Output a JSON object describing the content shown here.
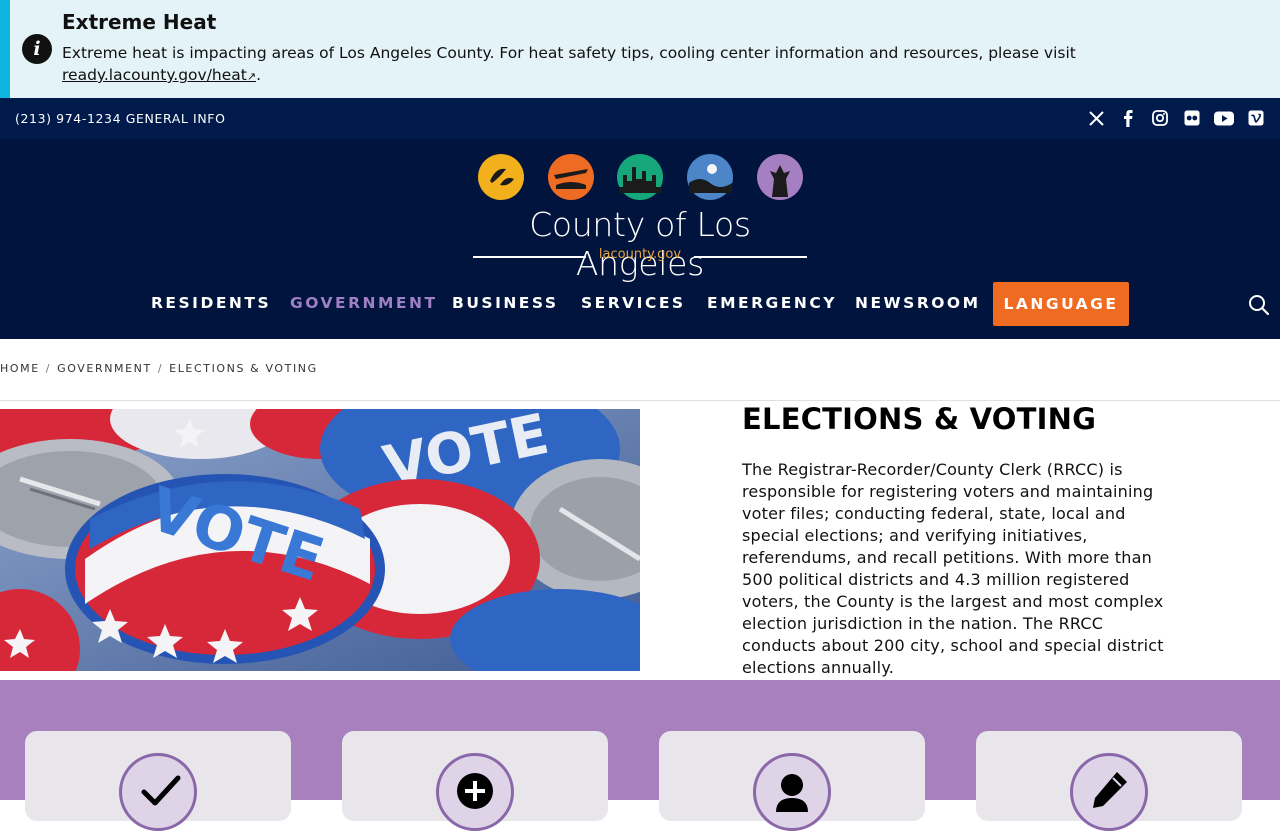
{
  "alert": {
    "title": "Extreme Heat",
    "text": "Extreme heat is impacting areas of Los Angeles County. For heat safety tips, cooling center information and resources, please visit",
    "link": "ready.lacounty.gov/heat",
    "icon": "info-icon"
  },
  "topbar": {
    "phone": "(213) 974-1234 GENERAL INFO",
    "social": [
      "x-icon",
      "facebook-icon",
      "instagram-icon",
      "flickr-icon",
      "youtube-icon",
      "vimeo-icon"
    ]
  },
  "logo": {
    "title": "County of Los Angeles",
    "subtitle": "lacounty.gov"
  },
  "nav": {
    "items": [
      "RESIDENTS",
      "GOVERNMENT",
      "BUSINESS",
      "SERVICES",
      "EMERGENCY",
      "NEWSROOM"
    ],
    "active": "GOVERNMENT",
    "language": "LANGUAGE"
  },
  "breadcrumb": [
    "HOME",
    "GOVERNMENT",
    "ELECTIONS & VOTING"
  ],
  "main": {
    "title": "ELECTIONS & VOTING",
    "intro": "The Registrar-Recorder/County Clerk (RRCC) is responsible for registering voters and maintaining voter files; conducting federal, state, local and special elections; and verifying initiatives, referendums, and recall petitions. With more than 500 political districts and 4.3 million registered voters, the County is the largest and most complex election jurisdiction in the nation. The RRCC conducts about 200 city, school and special district elections annually.",
    "image_text": "VOTE"
  },
  "cards": [
    "check-icon",
    "plus-circle-icon",
    "user-icon",
    "pencil-icon"
  ],
  "colors": {
    "alert_bg": "#e4f3f8",
    "alert_accent": "#0db4e0",
    "topbar": "#001a4c",
    "header": "#00143d",
    "nav_active": "#9f7fc6",
    "language_button": "#ef6b22",
    "card_band": "#a880be"
  }
}
